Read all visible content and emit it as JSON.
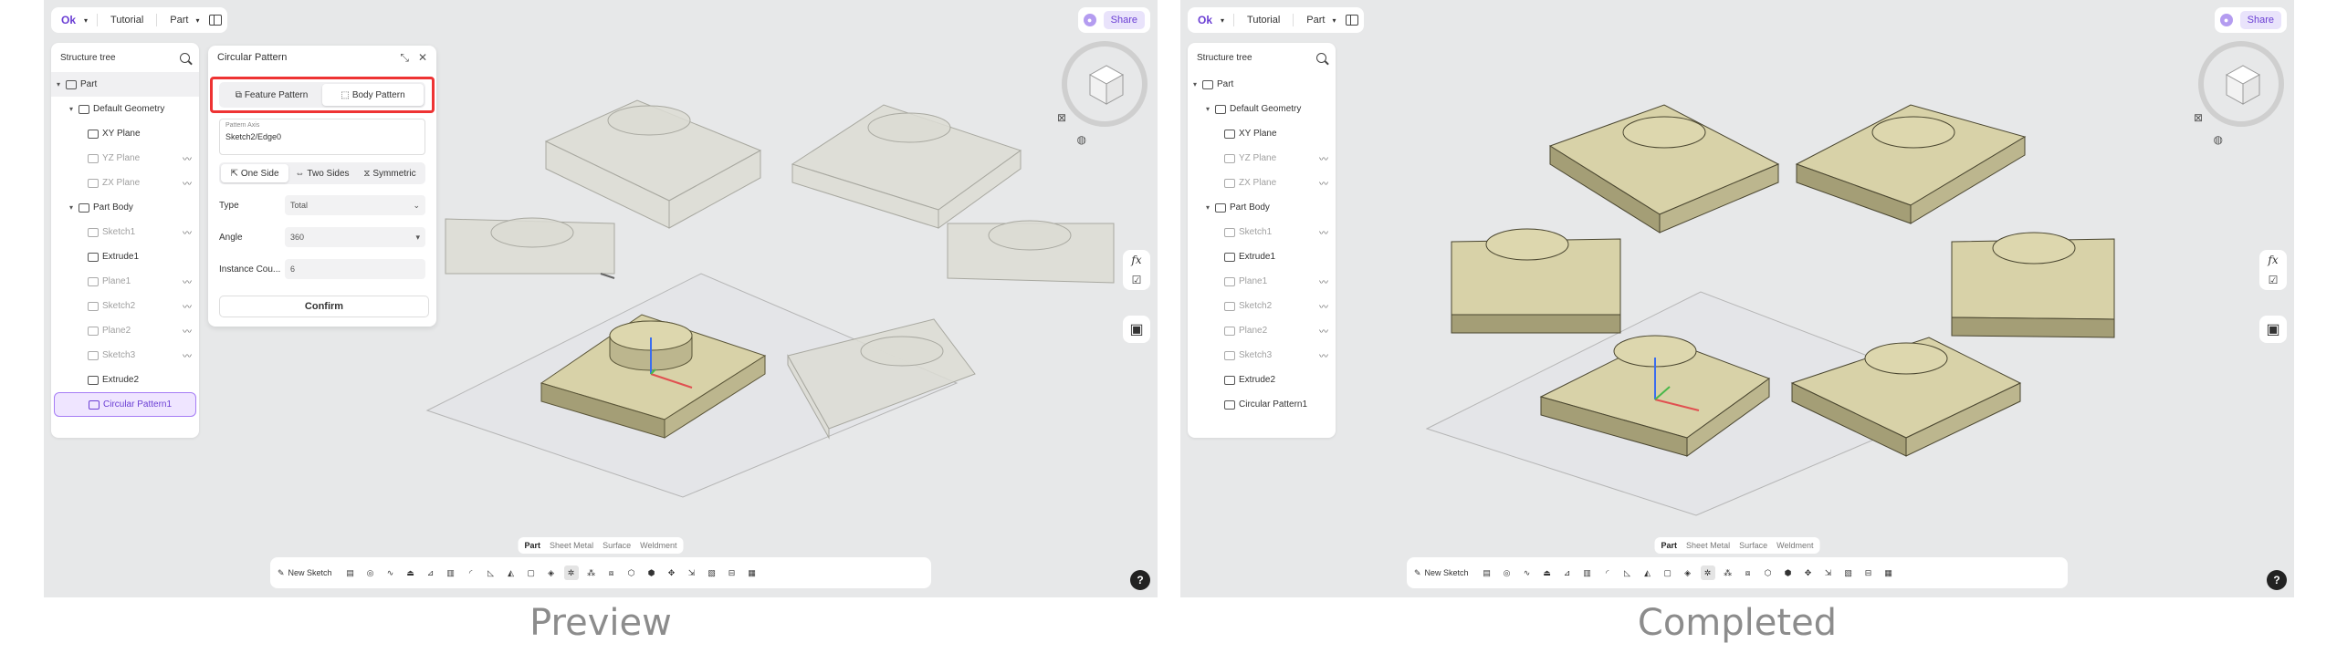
{
  "captions": {
    "left": "Preview",
    "right": "Completed"
  },
  "topbar": {
    "breadcrumb_home": "Tutorial",
    "part_menu": "Part",
    "share": "Share",
    "logo": "Ok"
  },
  "tree": {
    "title": "Structure tree",
    "items": [
      {
        "label": "Part"
      },
      {
        "label": "Default Geometry"
      },
      {
        "label": "XY Plane"
      },
      {
        "label": "YZ Plane"
      },
      {
        "label": "ZX Plane"
      },
      {
        "label": "Part Body"
      },
      {
        "label": "Sketch1"
      },
      {
        "label": "Extrude1"
      },
      {
        "label": "Plane1"
      },
      {
        "label": "Sketch2"
      },
      {
        "label": "Plane2"
      },
      {
        "label": "Sketch3"
      },
      {
        "label": "Extrude2"
      },
      {
        "label": "Circular Pattern1"
      }
    ]
  },
  "dialog": {
    "title": "Circular Pattern",
    "feature_pattern": "Feature Pattern",
    "body_pattern": "Body Pattern",
    "axis_label": "Pattern Axis",
    "axis_value": "Sketch2/Edge0",
    "one_side": "One Side",
    "two_sides": "Two Sides",
    "symmetric": "Symmetric",
    "type_label": "Type",
    "type_value": "Total",
    "angle_label": "Angle",
    "angle_value": "360",
    "count_label": "Instance Cou...",
    "count_value": "6",
    "confirm": "Confirm"
  },
  "workspace_tabs": [
    "Part",
    "Sheet Metal",
    "Surface",
    "Weldment"
  ],
  "bottombar": {
    "new_sketch": "New Sketch"
  },
  "right_tools": {
    "fx": "fx"
  },
  "help": "?",
  "colors": {
    "accent": "#6b3fd4",
    "body": "#d8d2a8",
    "ghost": "#dcdcd3",
    "highlight": "#e33333"
  }
}
